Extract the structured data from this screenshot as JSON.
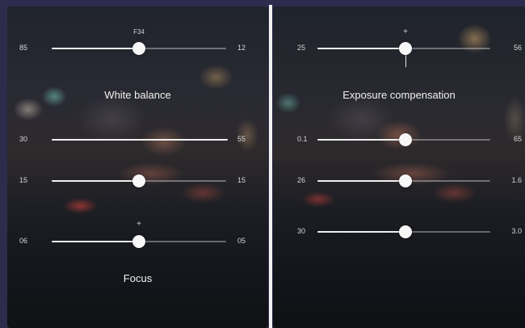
{
  "accent_color": "#ffffff",
  "left_panel": {
    "title_white_balance": "White balance",
    "title_focus": "Focus",
    "sliders": [
      {
        "min_label": "85",
        "max_label": "12",
        "value": 0.5,
        "marker": "F34"
      },
      {
        "min_label": "30",
        "max_label": "55",
        "value": 1.0
      },
      {
        "min_label": "15",
        "max_label": "15",
        "value": 0.5
      },
      {
        "min_label": "06",
        "max_label": "05",
        "value": 0.5,
        "marker": "+"
      }
    ]
  },
  "right_panel": {
    "title_exposure": "Exposure compensation",
    "sliders": [
      {
        "min_label": "25",
        "max_label": "56",
        "value": 0.5,
        "marker": "+"
      },
      {
        "min_label": "0.1",
        "max_label": "65",
        "value": 0.5
      },
      {
        "min_label": "26",
        "max_label": "1.6",
        "value": 0.5
      },
      {
        "min_label": "30",
        "max_label": "3.0",
        "value": 0.5
      }
    ]
  }
}
